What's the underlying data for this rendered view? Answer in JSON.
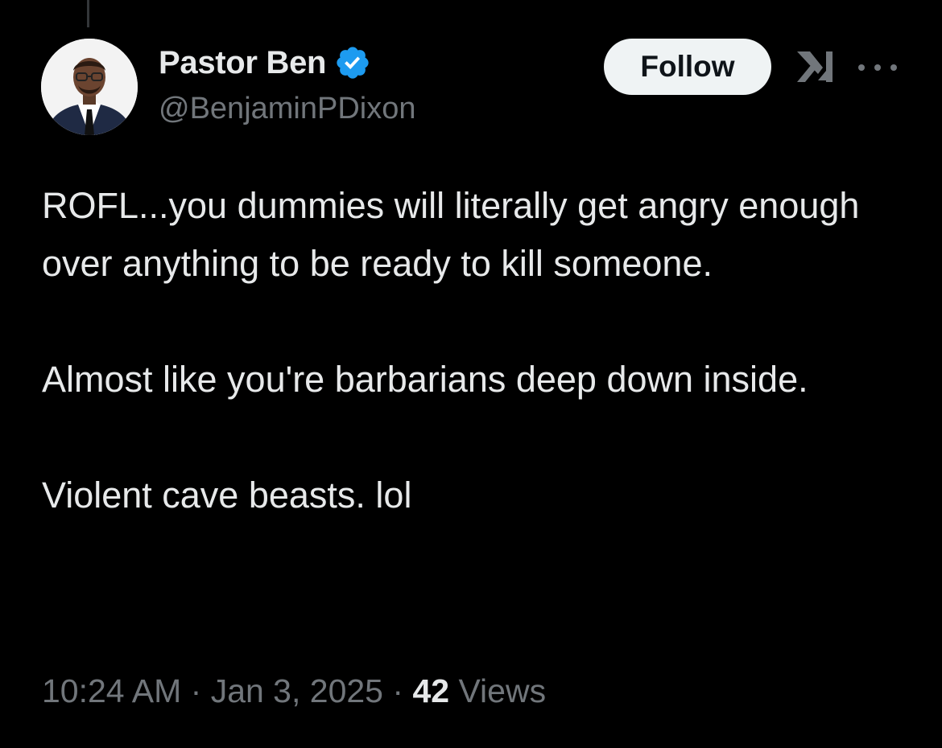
{
  "author": {
    "display_name": "Pastor Ben",
    "handle": "@BenjaminPDixon",
    "verified": true,
    "verified_color": "#1d9bf0"
  },
  "actions": {
    "follow_label": "Follow",
    "grok_icon": "grok-icon",
    "more_icon": "more-icon"
  },
  "tweet": {
    "paragraphs": [
      "ROFL...you dummies will literally get angry enough over anything to be ready to kill someone.",
      "Almost like you're barbarians deep down inside.",
      "Violent cave beasts. lol"
    ]
  },
  "meta": {
    "time": "10:24 AM",
    "date": "Jan 3, 2025",
    "views_count": "42",
    "views_label": "Views"
  },
  "colors": {
    "background": "#000000",
    "text": "#e7e9ea",
    "secondary": "#71767b",
    "follow_bg": "#eff3f4",
    "follow_text": "#0f1419"
  }
}
